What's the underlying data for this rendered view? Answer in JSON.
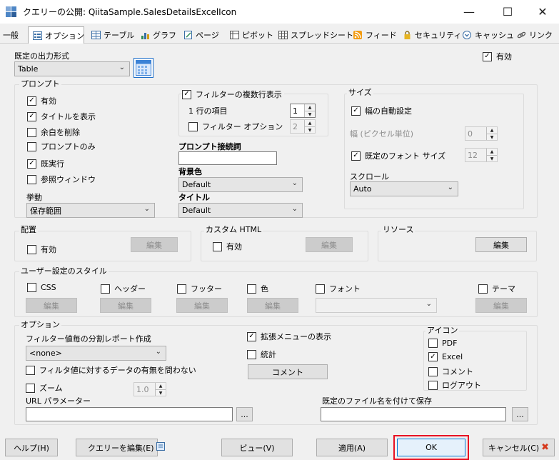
{
  "window": {
    "title": "クエリーの公開: QiitaSample.SalesDetailsExcelIcon",
    "minimize": "—",
    "maximize": "☐",
    "close": "✕"
  },
  "tabs": [
    {
      "label": "一般"
    },
    {
      "label": "オプション"
    },
    {
      "label": "テーブル"
    },
    {
      "label": "グラフ"
    },
    {
      "label": "ページ"
    },
    {
      "label": "ピボット"
    },
    {
      "label": "スプレッドシート"
    },
    {
      "label": "フィード"
    },
    {
      "label": "セキュリティ"
    },
    {
      "label": "キャッシュ"
    },
    {
      "label": "リンク"
    }
  ],
  "output": {
    "label": "既定の出力形式",
    "value": "Table",
    "enabled_label": "有効",
    "enabled": true
  },
  "prompt": {
    "group_label": "プロンプト",
    "items": [
      {
        "label": "有効",
        "checked": true
      },
      {
        "label": "タイトルを表示",
        "checked": true
      },
      {
        "label": "余白を削除",
        "checked": false
      },
      {
        "label": "プロンプトのみ",
        "checked": false
      },
      {
        "label": "既実行",
        "checked": true
      },
      {
        "label": "参照ウィンドウ",
        "checked": false
      }
    ],
    "behavior_label": "挙動",
    "behavior_value": "保存範囲"
  },
  "filter": {
    "multi_label": "フィルターの複数行表示",
    "per_row_label": "1 行の項目",
    "per_row_value": "1",
    "option_label": "フィルター オプション",
    "option_value": "2",
    "connector_label": "プロンプト接続詞",
    "connector_value": "",
    "bgcolor_label": "背景色",
    "bgcolor_value": "Default",
    "title_label": "タイトル",
    "title_value": "Default"
  },
  "size": {
    "group_label": "サイズ",
    "auto_width_label": "幅の自動設定",
    "width_label": "幅 (ピクセル単位)",
    "width_value": "0",
    "font_label": "既定のフォント サイズ",
    "font_value": "12",
    "scroll_label": "スクロール",
    "scroll_value": "Auto"
  },
  "placement": {
    "group_label": "配置",
    "enabled_label": "有効",
    "edit": "編集"
  },
  "custom_html": {
    "group_label": "カスタム HTML",
    "enabled_label": "有効",
    "edit": "編集"
  },
  "resources": {
    "group_label": "リソース",
    "edit": "編集"
  },
  "styles": {
    "group_label": "ユーザー設定のスタイル",
    "items": [
      {
        "label": "CSS",
        "edit": "編集"
      },
      {
        "label": "ヘッダー",
        "edit": "編集"
      },
      {
        "label": "フッター",
        "edit": "編集"
      },
      {
        "label": "色",
        "edit": "編集"
      },
      {
        "label": "フォント",
        "edit": ""
      },
      {
        "label": "テーマ",
        "edit": "編集"
      }
    ]
  },
  "options": {
    "group_label": "オプション",
    "split_label": "フィルター値毎の分割レポート作成",
    "split_value": "<none>",
    "ignore_label": "フィルタ値に対するデータの有無を問わない",
    "zoom_label": "ズーム",
    "zoom_value": "1.0",
    "url_label": "URL パラメーター",
    "url_value": "",
    "browse": "...",
    "ext_menu_label": "拡張メニューの表示",
    "stats_label": "統計",
    "comment_button": "コメント",
    "save_label": "既定のファイル名を付けて保存",
    "save_value": "",
    "browse2": "..."
  },
  "icons": {
    "group_label": "アイコン",
    "items": [
      {
        "label": "PDF",
        "checked": false
      },
      {
        "label": "Excel",
        "checked": true
      },
      {
        "label": "コメント",
        "checked": false
      },
      {
        "label": "ログアウト",
        "checked": false
      }
    ]
  },
  "footer": {
    "help": "ヘルプ(H)",
    "edit_query": "クエリーを編集(E)",
    "view": "ビュー(V)",
    "apply": "適用(A)",
    "ok": "OK",
    "cancel": "キャンセル(C)"
  },
  "colors": {
    "accent": "#0078d7",
    "highlight": "#e81123",
    "cancel_x": "#d63a1d"
  }
}
